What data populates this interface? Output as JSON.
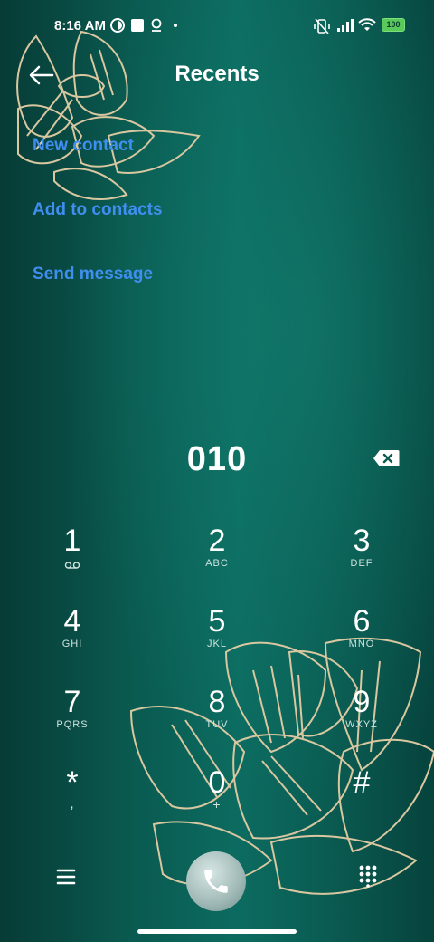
{
  "status_bar": {
    "time": "8:16 AM",
    "left_icons": [
      "data-saver-icon",
      "square-notification-icon",
      "pin-icon",
      "dot-icon"
    ],
    "right_icons": [
      "vibrate-icon",
      "signal-icon",
      "wifi-icon",
      "battery-icon"
    ],
    "battery_level": "100"
  },
  "header": {
    "title": "Recents",
    "back_icon": "back-arrow-icon"
  },
  "actions": {
    "new_contact": "New contact",
    "add_to_contacts": "Add to contacts",
    "send_message": "Send message"
  },
  "dialer": {
    "number": "010",
    "keys": [
      {
        "digit": "1",
        "sub": ""
      },
      {
        "digit": "2",
        "sub": "ABC"
      },
      {
        "digit": "3",
        "sub": "DEF"
      },
      {
        "digit": "4",
        "sub": "GHI"
      },
      {
        "digit": "5",
        "sub": "JKL"
      },
      {
        "digit": "6",
        "sub": "MNO"
      },
      {
        "digit": "7",
        "sub": "PQRS"
      },
      {
        "digit": "8",
        "sub": "TUV"
      },
      {
        "digit": "9",
        "sub": "WXYZ"
      },
      {
        "digit": "*",
        "sub": ","
      },
      {
        "digit": "0",
        "sub": "+"
      },
      {
        "digit": "#",
        "sub": ""
      }
    ]
  },
  "bottom_bar": {
    "left_icon": "menu-icon",
    "center_icon": "phone-call-icon",
    "right_icon": "dialpad-icon"
  },
  "colors": {
    "accent": "#3f8ef0",
    "background": "#0a5a50",
    "wallpaper_line": "#d8c7a0"
  }
}
